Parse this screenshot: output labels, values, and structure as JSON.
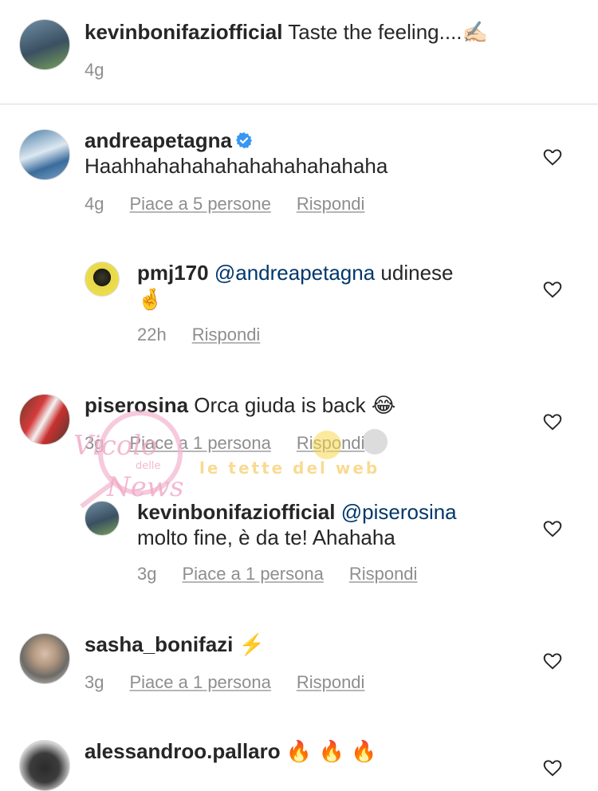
{
  "caption": {
    "username": "kevinbonifaziofficial",
    "text": "Taste the feeling....✍🏻",
    "time": "4g"
  },
  "comments": [
    {
      "username": "andreapetagna",
      "verified": true,
      "text": "Haahhahahahahahahahahahaha",
      "time": "4g",
      "likes": "Piace a 5 persone",
      "reply": "Rispondi"
    },
    {
      "username": "pmj170",
      "mention": "@andreapetagna",
      "text": "udinese",
      "text2": "🤞",
      "time": "22h",
      "reply": "Rispondi"
    },
    {
      "username": "piserosina",
      "text": "Orca giuda is back 😂",
      "time": "3g",
      "likes": "Piace a 1 persona",
      "reply": "Rispondi"
    },
    {
      "username": "kevinbonifaziofficial",
      "mention": "@piserosina",
      "text": "molto fine, è da te! Ahahaha",
      "time": "3g",
      "likes": "Piace a 1 persona",
      "reply": "Rispondi"
    },
    {
      "username": "sasha_bonifazi",
      "text": "⚡️",
      "time": "3g",
      "likes": "Piace a 1 persona",
      "reply": "Rispondi"
    },
    {
      "username": "alessandroo.pallaro",
      "text": "🔥 🔥 🔥"
    }
  ],
  "watermark": {
    "line1": "Vicolo",
    "line2": "delle",
    "line3": "News",
    "line4": "le tette del web"
  },
  "colors": {
    "text": "#262626",
    "meta": "#8e8e8e",
    "mention": "#00376b",
    "verified": "#3897f0",
    "divider": "#dbdbdb"
  },
  "icons": {
    "like": "heart-outline-icon",
    "verified": "verified-badge-icon"
  }
}
